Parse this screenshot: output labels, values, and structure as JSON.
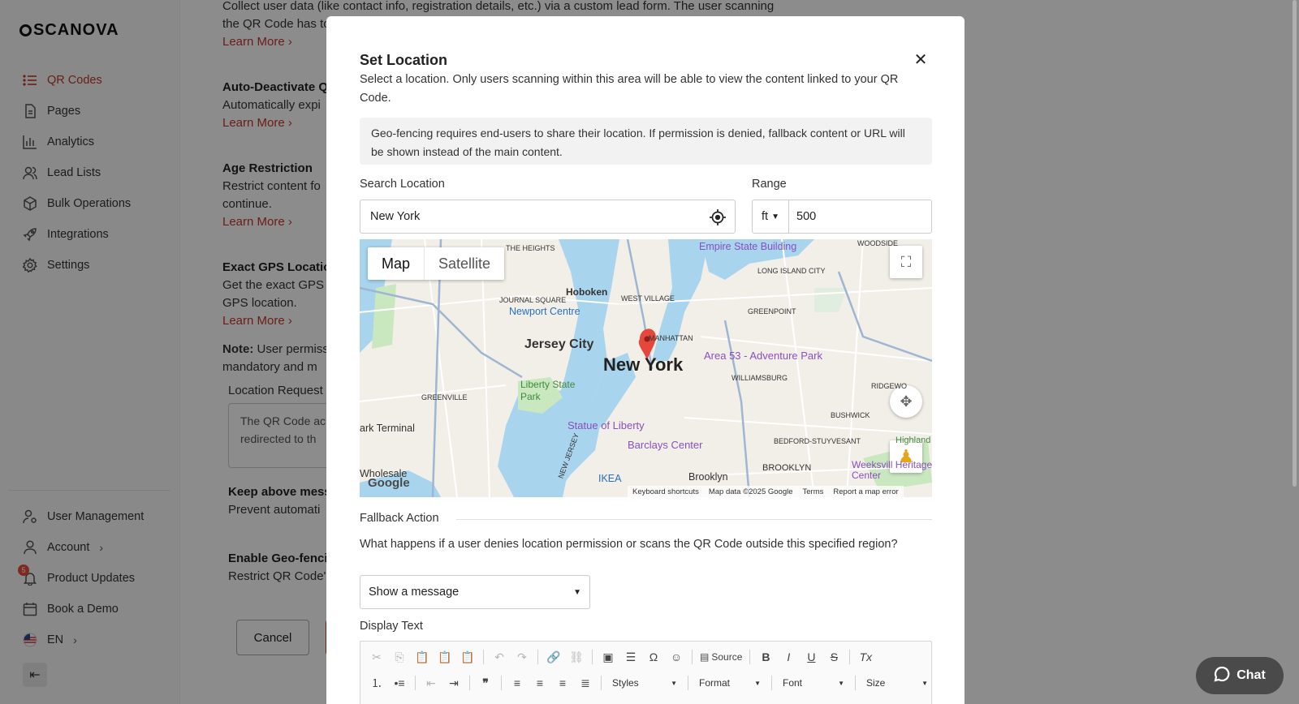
{
  "sidebar": {
    "logo": "SCANOVA",
    "items": [
      {
        "label": "QR Codes",
        "icon": "list-icon"
      },
      {
        "label": "Pages",
        "icon": "page-icon"
      },
      {
        "label": "Analytics",
        "icon": "bar-chart-icon"
      },
      {
        "label": "Lead Lists",
        "icon": "users-icon"
      },
      {
        "label": "Bulk Operations",
        "icon": "cube-icon"
      },
      {
        "label": "Integrations",
        "icon": "rocket-icon"
      },
      {
        "label": "Settings",
        "icon": "gear-icon"
      }
    ],
    "bottom": [
      {
        "label": "User Management",
        "icon": "user-cog-icon"
      },
      {
        "label": "Account",
        "icon": "user-icon"
      },
      {
        "label": "Product Updates",
        "icon": "bell-icon",
        "badge": "5"
      },
      {
        "label": "Book a Demo",
        "icon": "calendar-icon"
      },
      {
        "label": "EN",
        "icon": "flag-us-icon"
      }
    ],
    "collapse_icon": "collapse-left-icon"
  },
  "background": {
    "lead_desc_1": "Collect user data (like contact info, registration details, etc.) via a custom lead form. The user scanning",
    "lead_desc_2": "the QR Code has to",
    "learn_more": "Learn More",
    "auto_title": "Auto-Deactivate Q",
    "auto_desc": "Automatically expi",
    "age_title": "Age Restriction",
    "age_desc_1": "Restrict content fo",
    "age_desc_2": "continue.",
    "gps_title": "Exact GPS Locatio",
    "gps_desc_1": "Get the exact GPS",
    "gps_desc_2": "GPS location.",
    "note_bold": "Note:",
    "note_text_1": " User permiss",
    "note_text_2": "mandatory and m",
    "location_request": "Location Request",
    "textarea_1": "The QR Code ac",
    "textarea_2": "redirected to th",
    "keep_title": "Keep above mess",
    "keep_desc": "Prevent automati",
    "geo_title": "Enable Geo-fenci",
    "geo_desc": "Restrict QR Code'",
    "cancel": "Cancel"
  },
  "modal": {
    "title": "Set Location",
    "description": "Select a location. Only users scanning within this area will be able to view the content linked to your QR Code.",
    "info": "Geo-fencing requires end-users to share their location. If permission is denied, fallback content or URL will be shown instead of the main content.",
    "search_label": "Search Location",
    "search_value": "New York",
    "range_label": "Range",
    "range_unit": "ft",
    "range_value": "500",
    "map": {
      "tab_map": "Map",
      "tab_satellite": "Satellite",
      "labels": {
        "heights": "THE HEIGHTS",
        "empire": "Empire State Building",
        "woodside": "WOODSIDE",
        "lic": "LONG ISLAND CITY",
        "hoboken": "Hoboken",
        "journal": "JOURNAL SQUARE",
        "west_village": "WEST VILLAGE",
        "newport": "Newport Centre",
        "greenpoint": "GREENPOINT",
        "jersey_city": "Jersey City",
        "manhattan": "MANHATTAN",
        "new_york": "New York",
        "area53": "Area 53 - Adventure Park",
        "williamsburg": "WILLIAMSBURG",
        "liberty_state": "Liberty State Park",
        "greenville": "GREENVILLE",
        "ridgewood": "RIDGEWO",
        "terminal": "ark Terminal",
        "statue": "Statue of Liberty",
        "bushwick": "BUSHWICK",
        "barclays": "Barclays Center",
        "bedford": "BEDFORD-STUYVESANT",
        "brooklyn_caps": "BROOKLYN",
        "weeksville": "Weeksvill Heritage Center",
        "wholesale": "Wholesale",
        "ikea": "IKEA",
        "brooklyn": "Brooklyn",
        "highland": "Highland",
        "new_jersey": "NEW JERSEY"
      },
      "footer_shortcuts": "Keyboard shortcuts",
      "footer_data": "Map data ©2025 Google",
      "footer_terms": "Terms",
      "footer_report": "Report a map error",
      "google": "Google"
    },
    "fallback_label": "Fallback Action",
    "fallback_question": "What happens if a user denies location permission or scans the QR Code outside this specified region?",
    "fallback_value": "Show a message",
    "display_text_label": "Display Text",
    "editor": {
      "source": "Source",
      "styles": "Styles",
      "format": "Format",
      "font": "Font",
      "size": "Size"
    }
  },
  "chat": {
    "label": "Chat"
  },
  "colors": {
    "accent": "#c0392b",
    "water": "#a8d4ee",
    "park": "#c9e8c0"
  }
}
